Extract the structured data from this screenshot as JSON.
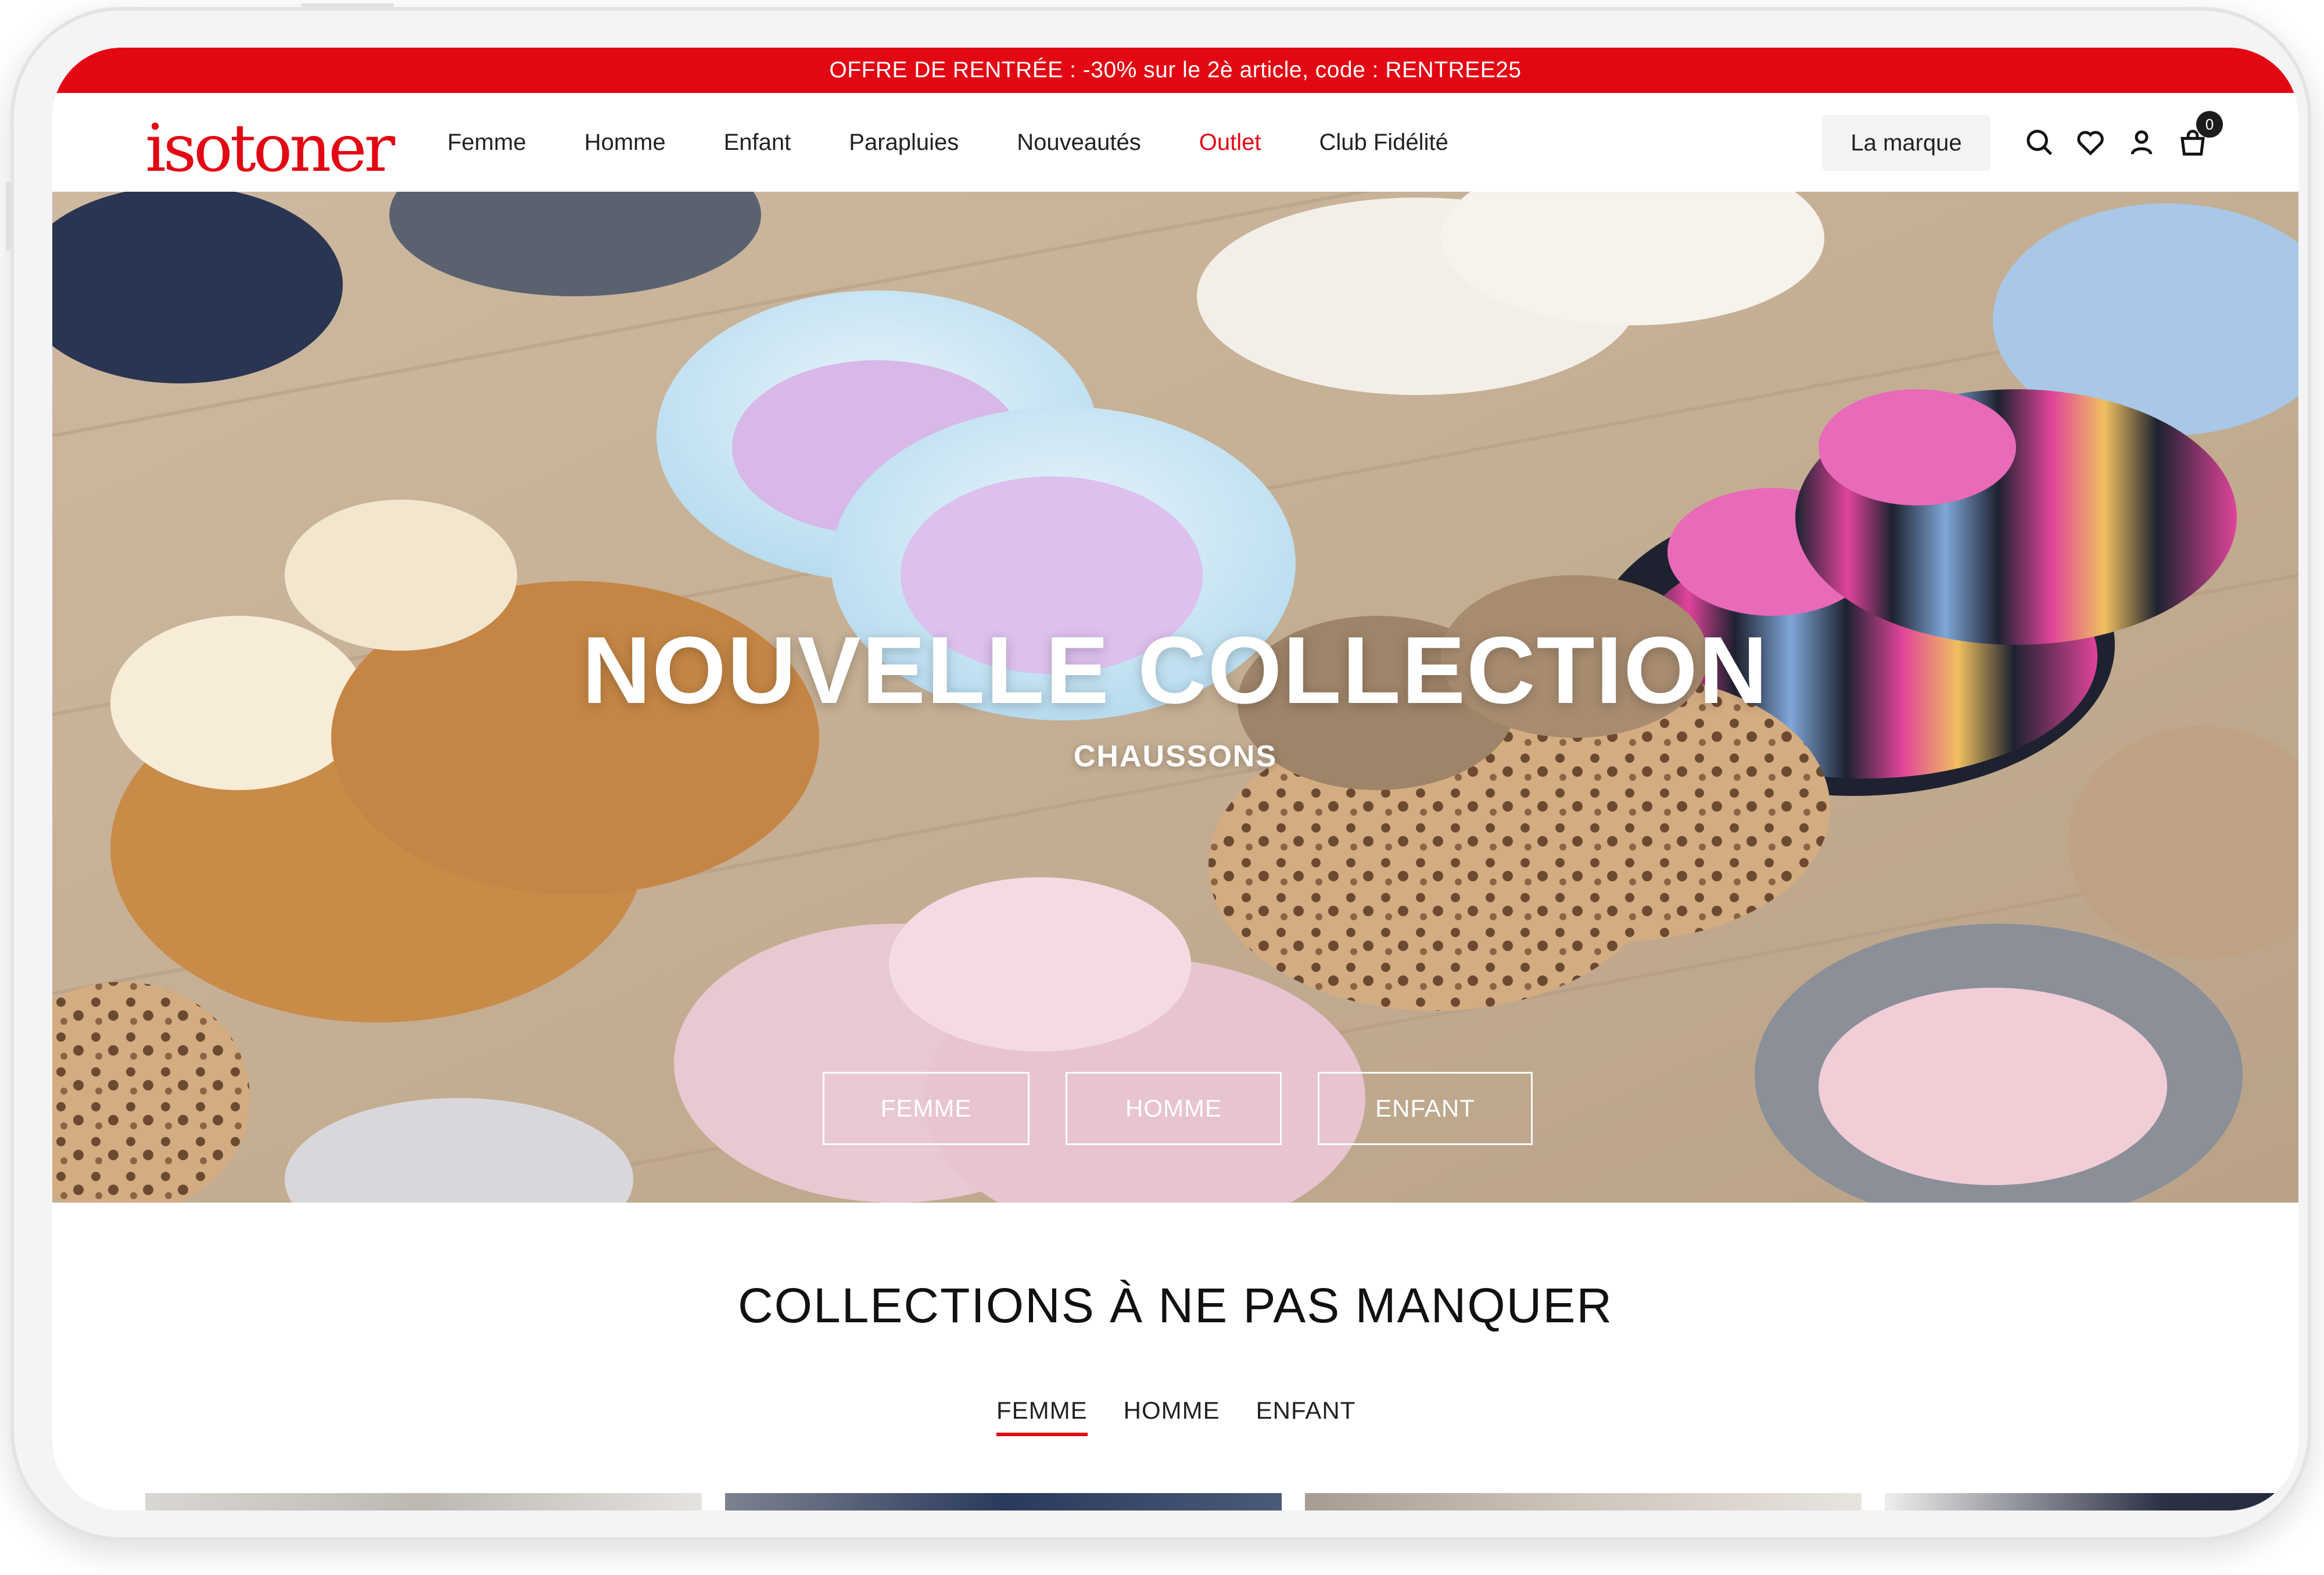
{
  "promo": {
    "text": "OFFRE DE RENTRÉE : -30% sur le 2è article, code : RENTREE25"
  },
  "header": {
    "logo": "isotoner",
    "nav": [
      "Femme",
      "Homme",
      "Enfant",
      "Parapluies",
      "Nouveautés",
      "Outlet",
      "Club Fidélité"
    ],
    "brand_button": "La marque",
    "icons": [
      "search-icon",
      "heart-icon",
      "user-icon",
      "bag-icon"
    ],
    "cart_count": "0"
  },
  "hero": {
    "title": "NOUVELLE COLLECTION",
    "subtitle": "CHAUSSONS",
    "buttons": [
      "FEMME",
      "HOMME",
      "ENFANT"
    ]
  },
  "collections": {
    "title": "COLLECTIONS À NE PAS MANQUER",
    "tabs": [
      "FEMME",
      "HOMME",
      "ENFANT"
    ],
    "active_tab": "FEMME"
  },
  "colors": {
    "brand_red": "#e30613",
    "text_dark": "#222222"
  }
}
